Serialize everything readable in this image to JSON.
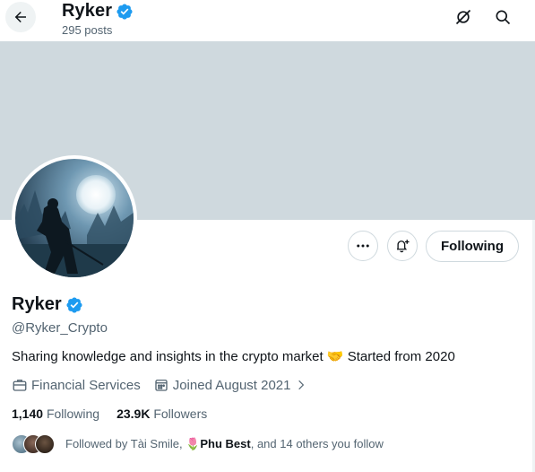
{
  "header": {
    "title": "Ryker",
    "post_count": "295 posts"
  },
  "actions": {
    "following_label": "Following"
  },
  "profile": {
    "name": "Ryker",
    "handle": "@Ryker_Crypto",
    "bio_text": "Sharing knowledge and insights in the crypto market",
    "bio_emoji": "🤝",
    "bio_tail": "Started from 2020",
    "category": "Financial Services",
    "joined": "Joined August 2021"
  },
  "stats": {
    "following_count": "1,140",
    "following_label": "Following",
    "followers_count": "23.9K",
    "followers_label": "Followers"
  },
  "followed_by": {
    "prefix": "Followed by",
    "name1": "Tài Smile,",
    "emoji": "🌷",
    "name2": "Phu Best",
    "suffix": ", and 14 others you follow"
  },
  "icons": {
    "back": "arrow-left-icon",
    "verified": "verified-badge-icon",
    "grok": "grok-icon",
    "search": "search-icon",
    "more": "more-icon",
    "notify": "bell-plus-icon",
    "category": "briefcase-icon",
    "joined": "calendar-icon"
  },
  "colors": {
    "verified": "#1d9bf0",
    "banner": "#cfd9de",
    "secondary_text": "#536471"
  }
}
